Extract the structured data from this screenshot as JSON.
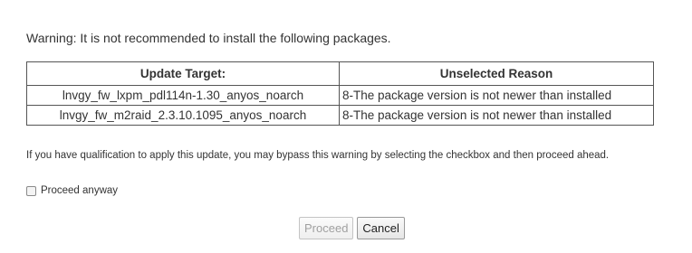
{
  "dialog": {
    "warning": "Warning: It is not recommended to install the following packages.",
    "table": {
      "headers": [
        "Update Target:",
        "Unselected Reason"
      ],
      "rows": [
        {
          "target": "lnvgy_fw_lxpm_pdl114n-1.30_anyos_noarch",
          "reason": "8-The package version is not newer than installed"
        },
        {
          "target": "lnvgy_fw_m2raid_2.3.10.1095_anyos_noarch",
          "reason": "8-The package version is not newer than installed"
        }
      ]
    },
    "qualification_text": "If you have qualification to apply this update, you may bypass this warning by selecting the checkbox and then proceed ahead.",
    "proceed_anyway_label": "Proceed anyway",
    "proceed_anyway_checked": false,
    "buttons": {
      "proceed": "Proceed",
      "cancel": "Cancel"
    }
  }
}
